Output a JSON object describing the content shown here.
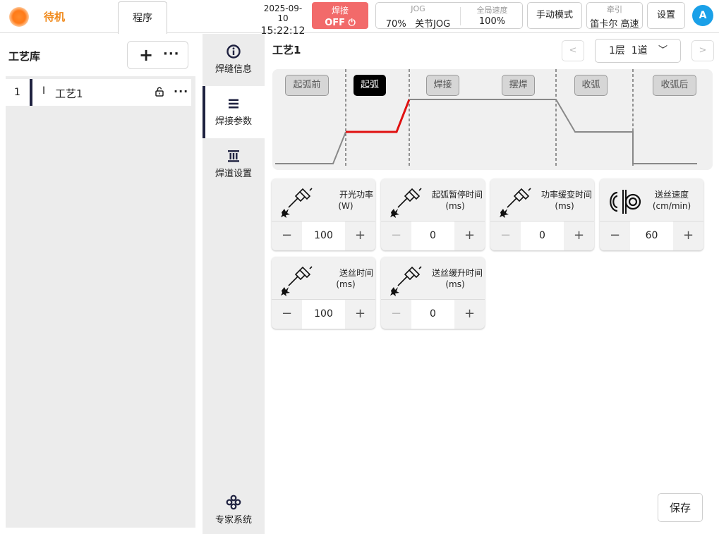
{
  "status": {
    "label": "待机",
    "color": "#f08a1c"
  },
  "tabs": {
    "program": "程序"
  },
  "datetime": {
    "date": "2025-09-10",
    "time": "15:22:12"
  },
  "weld_toggle": {
    "label": "焊接",
    "state": "OFF ⏻",
    "color": "#f26a6a"
  },
  "jog": {
    "label": "JOG",
    "value": "70%   关节JOG",
    "speed_label": "全局速度",
    "speed_value": "100%"
  },
  "mode_button": "手动模式",
  "drag": {
    "label": "牵引",
    "value": "笛卡尔 高速"
  },
  "settings_button": "设置",
  "avatar": "A",
  "library": {
    "title": "工艺库",
    "add_icon": "+",
    "more_icon": "···",
    "items": [
      {
        "index": "1",
        "cursor": "I",
        "name": "工艺1",
        "lock_icon": "unlock-icon",
        "more_icon": "···"
      }
    ]
  },
  "sidenav": {
    "items": [
      {
        "label": "焊缝信息",
        "icon": "info-icon"
      },
      {
        "label": "焊接参数",
        "icon": "menu-icon"
      },
      {
        "label": "焊道设置",
        "icon": "layers-icon"
      }
    ],
    "expert": {
      "label": "专家系统",
      "icon": "expert-icon"
    }
  },
  "main": {
    "title": "工艺1",
    "pager": {
      "prev": "<",
      "selection": "1层  1道",
      "chevron": "﹀",
      "next": ">"
    },
    "phases": [
      {
        "label": "起弧前",
        "active": false
      },
      {
        "label": "起弧",
        "active": true
      },
      {
        "label": "焊接",
        "active": false
      },
      {
        "label": "摆焊",
        "active": false
      },
      {
        "label": "收弧",
        "active": false
      },
      {
        "label": "收弧后",
        "active": false
      }
    ],
    "highlight_color": "#e01010",
    "params": [
      {
        "label1": "开光功率",
        "label2": "(W)",
        "value": "100",
        "icon": "torch-icon",
        "minus_disabled": false
      },
      {
        "label1": "起弧暂停时间",
        "label2": "(ms)",
        "value": "0",
        "icon": "torch-icon",
        "minus_disabled": true
      },
      {
        "label1": "功率缓变时间",
        "label2": "(ms)",
        "value": "0",
        "icon": "torch-icon",
        "minus_disabled": true
      },
      {
        "label1": "送丝速度",
        "label2": "(cm/min)",
        "value": "60",
        "icon": "wire-feed-icon",
        "minus_disabled": false
      },
      {
        "label1": "送丝时间",
        "label2": "(ms)",
        "value": "100",
        "icon": "torch-icon",
        "minus_disabled": false
      },
      {
        "label1": "送丝缓升时间",
        "label2": "(ms)",
        "value": "0",
        "icon": "torch-icon",
        "minus_disabled": true
      }
    ],
    "stepper": {
      "minus": "−",
      "plus": "+"
    },
    "save_button": "保存"
  }
}
